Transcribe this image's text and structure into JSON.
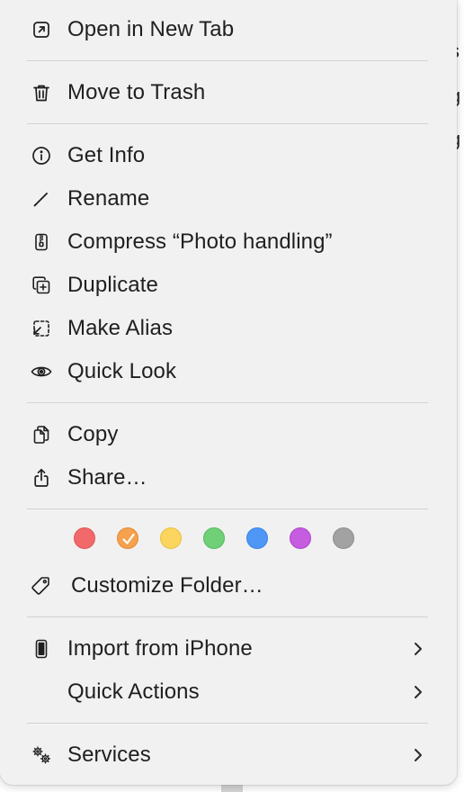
{
  "background": {
    "peek_text": [
      "s",
      "g",
      "g"
    ]
  },
  "menu": {
    "items": [
      {
        "id": "open-new-tab",
        "label": "Open in New Tab",
        "icon": "open-in-new-tab-icon"
      },
      {
        "id": "move-to-trash",
        "label": "Move to Trash",
        "icon": "trash-icon"
      },
      {
        "id": "get-info",
        "label": "Get Info",
        "icon": "info-icon"
      },
      {
        "id": "rename",
        "label": "Rename",
        "icon": "pencil-icon"
      },
      {
        "id": "compress",
        "label": "Compress “Photo handling”",
        "icon": "zip-archive-icon"
      },
      {
        "id": "duplicate",
        "label": "Duplicate",
        "icon": "duplicate-icon"
      },
      {
        "id": "make-alias",
        "label": "Make Alias",
        "icon": "alias-icon"
      },
      {
        "id": "quick-look",
        "label": "Quick Look",
        "icon": "eye-icon"
      },
      {
        "id": "copy",
        "label": "Copy",
        "icon": "copy-icon"
      },
      {
        "id": "share",
        "label": "Share…",
        "icon": "share-icon"
      },
      {
        "id": "customize-folder",
        "label": "Customize Folder…",
        "icon": "tag-icon"
      },
      {
        "id": "import-from-iphone",
        "label": "Import from iPhone",
        "icon": "iphone-icon",
        "submenu": true
      },
      {
        "id": "quick-actions",
        "label": "Quick Actions",
        "icon": "",
        "submenu": true
      },
      {
        "id": "services",
        "label": "Services",
        "icon": "gears-icon",
        "submenu": true
      }
    ],
    "tags": [
      {
        "name": "red",
        "fill": "#f2696b",
        "stroke": "#e05456",
        "checked": false
      },
      {
        "name": "orange",
        "fill": "#f5a14e",
        "stroke": "#e08a36",
        "checked": true
      },
      {
        "name": "yellow",
        "fill": "#fbd55e",
        "stroke": "#e9c040",
        "checked": false
      },
      {
        "name": "green",
        "fill": "#6fd078",
        "stroke": "#55b95e",
        "checked": false
      },
      {
        "name": "blue",
        "fill": "#4f97f6",
        "stroke": "#3b82e4",
        "checked": false
      },
      {
        "name": "purple",
        "fill": "#c65ce0",
        "stroke": "#ae46c8",
        "checked": false
      },
      {
        "name": "gray",
        "fill": "#a2a2a2",
        "stroke": "#8d8d8d",
        "checked": false
      }
    ]
  }
}
